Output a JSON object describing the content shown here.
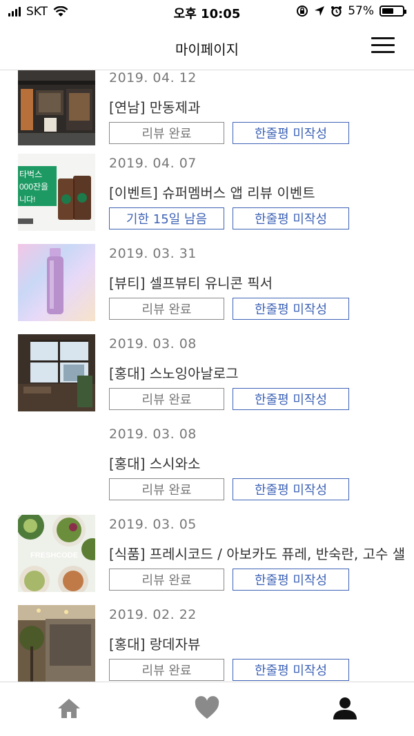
{
  "status_bar": {
    "carrier": "SKT",
    "time": "오후 10:05",
    "battery_percent": "57%",
    "battery_level": 0.57,
    "icons": [
      "signal-icon",
      "wifi-icon",
      "orientation-lock-icon",
      "location-icon",
      "alarm-icon",
      "battery-icon"
    ]
  },
  "header": {
    "title": "마이페이지",
    "menu_icon": "hamburger-menu-icon"
  },
  "items": [
    {
      "date": "2019. 04. 12",
      "title": "[연남] 만동제과",
      "status_label": "리뷰 완료",
      "status_type": "done",
      "review_label": "한줄평 미작성",
      "thumbnail": "bakery-storefront"
    },
    {
      "date": "2019. 04. 07",
      "title": "[이벤트] 슈퍼멤버스 앱 리뷰 이벤트",
      "status_label": "기한 15일 남음",
      "status_type": "deadline",
      "review_label": "한줄평 미작성",
      "thumbnail": "starbucks-coffee-banner",
      "thumb_text_1": "타벅스",
      "thumb_text_2": "000잔을",
      "thumb_text_3": "니다!"
    },
    {
      "date": "2019. 03. 31",
      "title": "[뷰티] 셀프뷰티 유니콘 픽서",
      "status_label": "리뷰 완료",
      "status_type": "done",
      "review_label": "한줄평 미작성",
      "thumbnail": "cosmetic-bottle"
    },
    {
      "date": "2019. 03. 08",
      "title": "[홍대] 스노잉아날로그",
      "status_label": "리뷰 완료",
      "status_type": "done",
      "review_label": "한줄평 미작성",
      "thumbnail": "cafe-window"
    },
    {
      "date": "2019. 03. 08",
      "title": "[홍대] 스시와소",
      "status_label": "리뷰 완료",
      "status_type": "done",
      "review_label": "한줄평 미작성",
      "thumbnail": ""
    },
    {
      "date": "2019. 03. 05",
      "title": "[식품] 프레시코드 / 아보카도 퓨레, 반숙란, 고수 샐",
      "status_label": "리뷰 완료",
      "status_type": "done",
      "review_label": "한줄평 미작성",
      "thumbnail": "salad-bowls",
      "thumb_text": "FRESHCODE"
    },
    {
      "date": "2019. 02. 22",
      "title": "[홍대] 랑데자뷰",
      "status_label": "리뷰 완료",
      "status_type": "done",
      "review_label": "한줄평 미작성",
      "thumbnail": "cafe-interior-stone-wall"
    }
  ],
  "tabbar": {
    "tabs": [
      "home-icon",
      "heart-icon",
      "person-icon"
    ],
    "active": "person-icon"
  },
  "colors": {
    "accent": "#3d62b5",
    "text": "#333333",
    "muted": "#777777",
    "border": "#d9d9d9"
  }
}
